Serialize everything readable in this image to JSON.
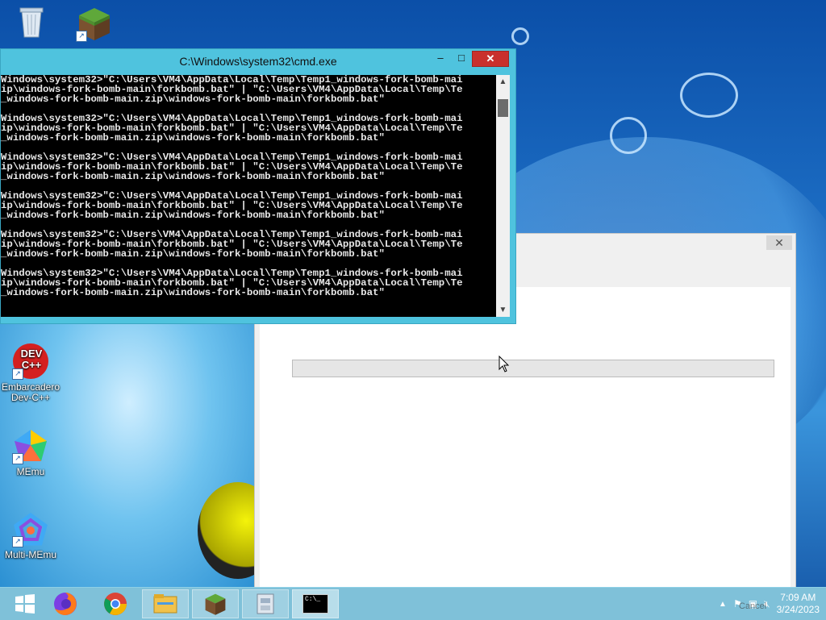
{
  "desktop": {
    "icons": [
      {
        "label": ""
      },
      {
        "label": ""
      },
      {
        "label": "Embarcadero Dev-C++"
      },
      {
        "label": "MEmu"
      },
      {
        "label": "Multi-MEmu"
      }
    ],
    "devcpp_logo_text": "DEV C++"
  },
  "cmd": {
    "title": "C:\\Windows\\system32\\cmd.exe",
    "minimize": "–",
    "maximize": "□",
    "close": "✕",
    "lines": [
      "Windows\\system32>\"C:\\Users\\VM4\\AppData\\Local\\Temp\\Temp1_windows-fork-bomb-mai",
      "ip\\windows-fork-bomb-main\\forkbomb.bat\" | \"C:\\Users\\VM4\\AppData\\Local\\Temp\\Te",
      "_windows-fork-bomb-main.zip\\windows-fork-bomb-main\\forkbomb.bat\""
    ],
    "scroll_up": "▲",
    "scroll_down": "▼"
  },
  "dialog": {
    "close": "✕"
  },
  "taskbar": {
    "clock_time": "7:09 AM",
    "clock_date": "3/24/2023",
    "cmd_icon_text": "C:\\_",
    "tray_label": "Cancel"
  },
  "colors": {
    "cmd_frame": "#4fc3de",
    "close_red": "#c9302c",
    "taskbar": "#78bed7"
  }
}
